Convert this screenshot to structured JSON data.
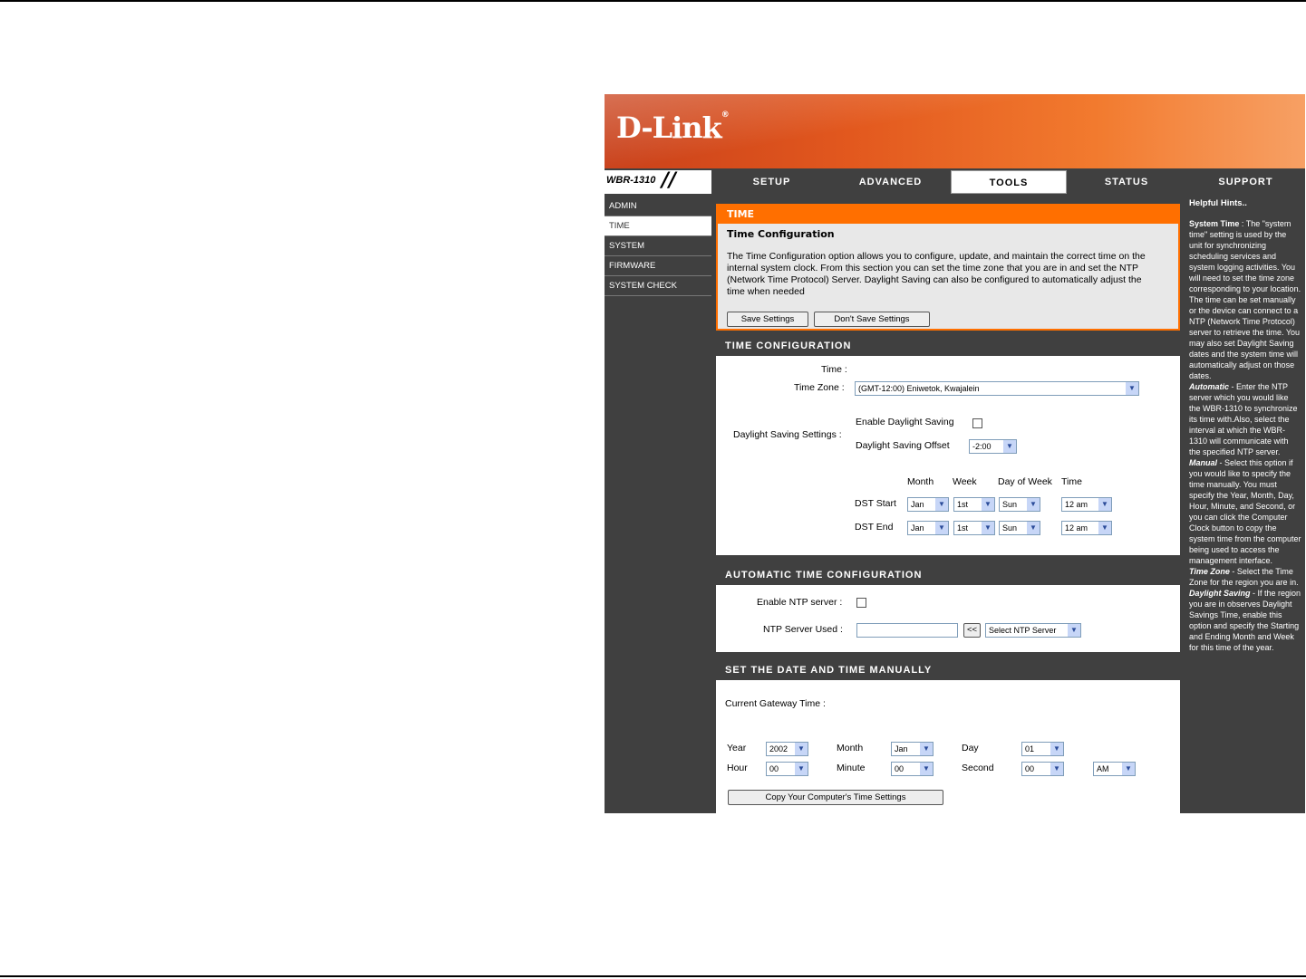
{
  "brand": {
    "logo": "D-Link",
    "reg": "®",
    "model": "WBR-1310"
  },
  "tabs": [
    {
      "label": "SETUP"
    },
    {
      "label": "ADVANCED"
    },
    {
      "label": "TOOLS"
    },
    {
      "label": "STATUS"
    },
    {
      "label": "SUPPORT"
    }
  ],
  "sidebar": [
    {
      "label": "ADMIN"
    },
    {
      "label": "TIME"
    },
    {
      "label": "SYSTEM"
    },
    {
      "label": "FIRMWARE"
    },
    {
      "label": "SYSTEM CHECK"
    }
  ],
  "intro": {
    "title": "TIME",
    "subtitle": "Time Configuration",
    "body": "The Time Configuration option allows you to configure, update, and maintain the correct time on the internal system clock. From this section you can set the time zone that you are in and set the NTP (Network Time Protocol) Server. Daylight Saving can also be configured to automatically adjust the time when needed",
    "save_label": "Save Settings",
    "dont_save_label": "Don't Save Settings"
  },
  "time_config": {
    "header": "TIME CONFIGURATION",
    "time_label": "Time :",
    "time_zone_label": "Time Zone :",
    "time_zone_value": "(GMT-12:00) Eniwetok, Kwajalein",
    "dst_settings_label": "Daylight Saving Settings :",
    "enable_dst_label": "Enable Daylight Saving",
    "dst_offset_label": "Daylight Saving Offset",
    "dst_offset_value": "-2:00",
    "col_month": "Month",
    "col_week": "Week",
    "col_dow": "Day of Week",
    "col_time": "Time",
    "dst_start_label": "DST Start",
    "dst_end_label": "DST End",
    "start": {
      "month": "Jan",
      "week": "1st",
      "dow": "Sun",
      "time": "12 am"
    },
    "end": {
      "month": "Jan",
      "week": "1st",
      "dow": "Sun",
      "time": "12 am"
    }
  },
  "auto_time": {
    "header": "AUTOMATIC TIME CONFIGURATION",
    "enable_ntp_label": "Enable NTP server :",
    "ntp_used_label": "NTP Server Used :",
    "ntp_value": "",
    "copy_arrow": "<<",
    "select_ntp": "Select NTP Server"
  },
  "manual": {
    "header": "SET THE DATE AND TIME MANUALLY",
    "gateway_time_label": "Current Gateway Time :",
    "year_label": "Year",
    "year": "2002",
    "month_label": "Month",
    "month": "Jan",
    "day_label": "Day",
    "day": "01",
    "hour_label": "Hour",
    "hour": "00",
    "minute_label": "Minute",
    "minute": "00",
    "second_label": "Second",
    "second": "00",
    "ampm": "AM",
    "copy_button": "Copy Your Computer's Time Settings"
  },
  "hints": {
    "title": "Helpful Hints..",
    "system_time_head": "System Time",
    "system_time_body": " : The \"system time\" setting is used by the unit for synchronizing scheduling services and system logging activities. You will need to set the time zone corresponding to your location. The time can be set manually or the device can connect to a NTP (Network Time Protocol) server to retrieve the time. You may also set Daylight Saving dates and the system time will automatically adjust on those dates.",
    "automatic_head": "Automatic",
    "automatic_body": " - Enter the NTP server which you would like the WBR-1310 to synchronize its time with.Also, select the interval at which the WBR-1310 will communicate with the specified NTP server.",
    "manual_head": "Manual",
    "manual_body": " - Select this option if you would like to specify the time manually. You must specify the Year, Month, Day, Hour, Minute, and Second, or you can click the Computer Clock button to copy the system time from the computer being used to access the management interface.",
    "timezone_head": "Time Zone",
    "timezone_body": " - Select the Time Zone for the region you are in.",
    "dst_head": "Daylight Saving",
    "dst_body": " - If the region you are in observes Daylight Savings Time, enable this option and specify the Starting and Ending Month and Week for this time of the year."
  }
}
